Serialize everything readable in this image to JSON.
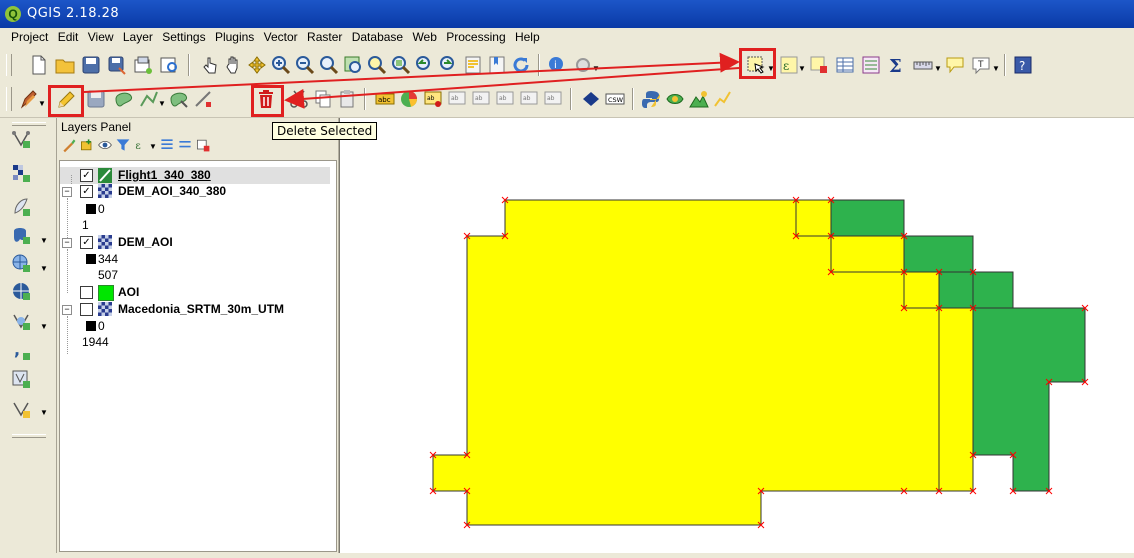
{
  "window": {
    "title": "QGIS 2.18.28"
  },
  "menu": [
    "Project",
    "Edit",
    "View",
    "Layer",
    "Settings",
    "Plugins",
    "Vector",
    "Raster",
    "Database",
    "Web",
    "Processing",
    "Help"
  ],
  "layers_panel": {
    "title": "Layers Panel",
    "layers": [
      {
        "name": "Flight1_340_380",
        "checked": true,
        "type": "vector-line"
      },
      {
        "name": "DEM_AOI_340_380",
        "checked": true,
        "type": "raster",
        "legend": [
          "0",
          "1"
        ]
      },
      {
        "name": "DEM_AOI",
        "checked": true,
        "type": "raster",
        "legend": [
          "344",
          "507"
        ]
      },
      {
        "name": "AOI",
        "checked": false,
        "type": "polygon",
        "color": "#00e600"
      },
      {
        "name": "Macedonia_SRTM_30m_UTM",
        "checked": false,
        "type": "raster",
        "legend": [
          "0",
          "1944"
        ]
      }
    ]
  },
  "tooltip": {
    "text": "Delete Selected"
  },
  "toolbar": {
    "highlighted": [
      "toggle-editing-icon",
      "delete-selected-icon",
      "select-features-icon"
    ],
    "csw_label": "CSW",
    "text_tool": "T",
    "help": "?"
  },
  "colors": {
    "polygon_yellow": "#ffff00",
    "polygon_green": "#2eb24d",
    "vertex_marker": "#ff0000",
    "highlight": "#e02020",
    "titlebar": "#0a3aa6"
  }
}
